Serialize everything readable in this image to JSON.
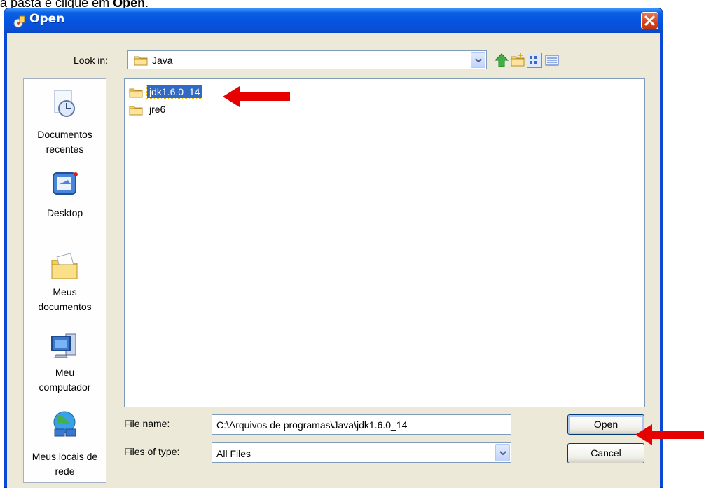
{
  "caption": {
    "prefix": "a pasta e clique em ",
    "bold": "Open",
    "suffix": "."
  },
  "window": {
    "title": "Open"
  },
  "look_in": {
    "label": "Look in:",
    "value": "Java"
  },
  "toolbar": [
    "up-one-level",
    "create-new-folder",
    "list-view",
    "details-view"
  ],
  "places": [
    {
      "label1": "Documentos",
      "label2": "recentes",
      "icon": "recent-documents-icon"
    },
    {
      "label1": "Desktop",
      "label2": "",
      "icon": "desktop-icon"
    },
    {
      "label1": "Meus",
      "label2": "documentos",
      "icon": "my-documents-icon"
    },
    {
      "label1": "Meu",
      "label2": "computador",
      "icon": "my-computer-icon"
    },
    {
      "label1": "Meus locais de",
      "label2": "rede",
      "icon": "network-places-icon"
    }
  ],
  "files": [
    {
      "name": "jdk1.6.0_14",
      "selected": true
    },
    {
      "name": "jre6",
      "selected": false
    }
  ],
  "file_name": {
    "label": "File name:",
    "value": "C:\\Arquivos de programas\\Java\\jdk1.6.0_14"
  },
  "file_type": {
    "label": "Files of type:",
    "value": "All Files"
  },
  "buttons": {
    "open": "Open",
    "cancel": "Cancel"
  },
  "colors": {
    "title_bar": "#0554e0",
    "selection": "#316ac5",
    "annotation_arrow": "#e60000",
    "dialog_face": "#ece9d8"
  }
}
